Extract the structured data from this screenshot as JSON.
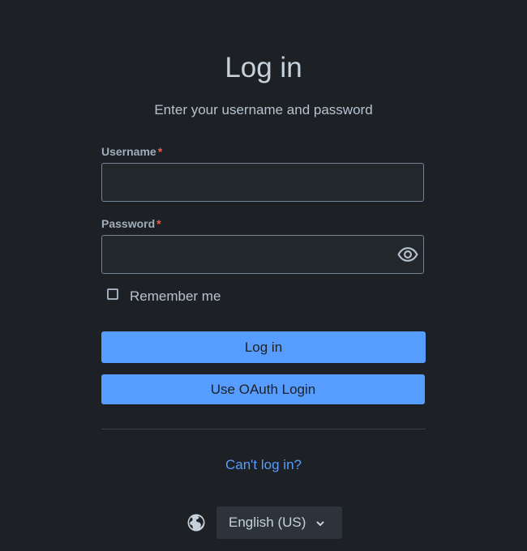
{
  "header": {
    "title": "Log in",
    "subtitle": "Enter your username and password"
  },
  "form": {
    "username": {
      "label": "Username",
      "required_marker": "*",
      "value": ""
    },
    "password": {
      "label": "Password",
      "required_marker": "*",
      "value": "",
      "toggle_icon": "eye-icon"
    },
    "remember_me": {
      "label": "Remember me",
      "checked": false
    },
    "login_button": "Log in",
    "oauth_button": "Use OAuth Login"
  },
  "footer": {
    "help_link": "Can't log in?",
    "language_icon": "globe-icon",
    "language": "English (US)"
  },
  "colors": {
    "background": "#1d2125",
    "primary": "#579dff",
    "required": "#ef5c48",
    "input_bg": "#22272b"
  }
}
